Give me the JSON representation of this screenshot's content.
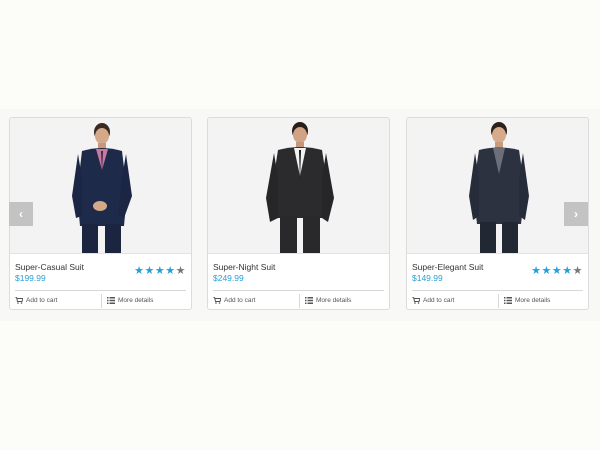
{
  "carousel": {
    "prev_icon": "chevron-left-icon",
    "next_icon": "chevron-right-icon",
    "products": [
      {
        "name": "Super-Casual Suit",
        "price": "$199.99",
        "rating": 4,
        "rating_max": 5,
        "add_label": "Add to cart",
        "details_label": "More details",
        "show_rating": true
      },
      {
        "name": "Super-Night Suit",
        "price": "$249.99",
        "rating": null,
        "rating_max": 5,
        "add_label": "Add to cart",
        "details_label": "More details",
        "show_rating": false
      },
      {
        "name": "Super-Elegant Suit",
        "price": "$149.99",
        "rating": 4,
        "rating_max": 5,
        "add_label": "Add to cart",
        "details_label": "More details",
        "show_rating": true
      }
    ]
  },
  "colors": {
    "accent": "#2a9fd6",
    "star_off": "#777777",
    "arrow_bg": "#c3c3c3"
  }
}
